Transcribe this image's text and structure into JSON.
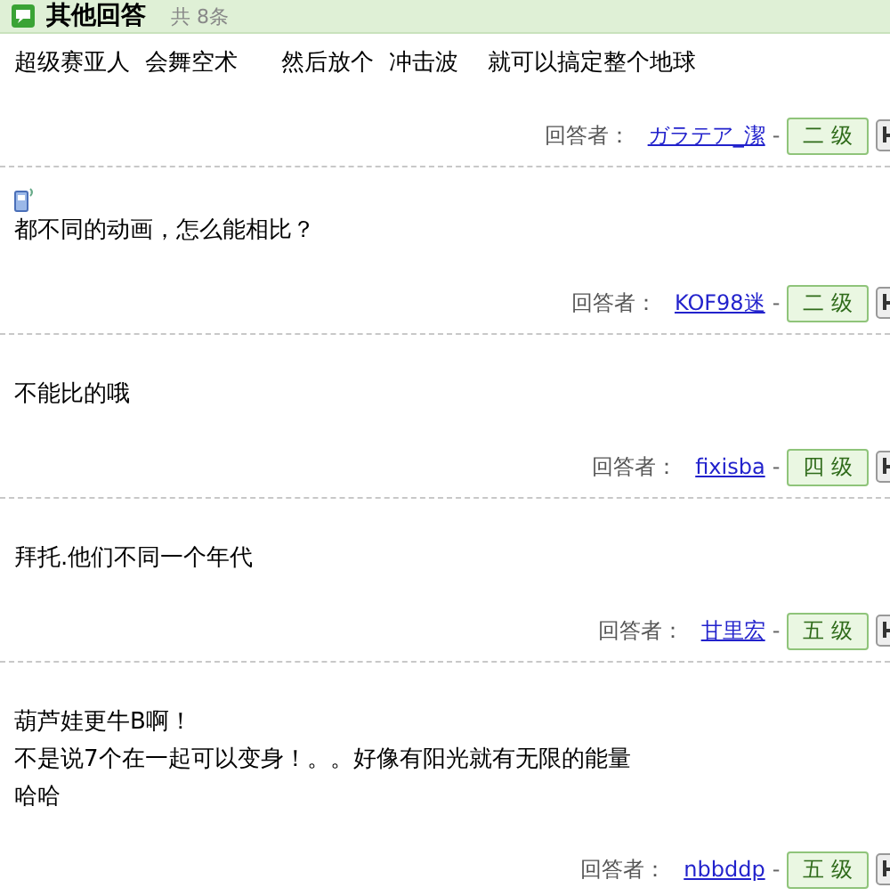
{
  "header": {
    "title": "其他回答",
    "count": "共 8条"
  },
  "answers": [
    {
      "lines": [
        "超级赛亚人  会舞空术      然后放个  冲击波    就可以搞定整个地球"
      ],
      "from_mobile": false,
      "label": "回答者：",
      "user": "ガラテア_潔",
      "dash": "-",
      "level": "二 级"
    },
    {
      "lines": [
        "都不同的动画，怎么能相比？"
      ],
      "from_mobile": true,
      "label": "回答者：",
      "user": "KOF98迷",
      "dash": "-",
      "level": "二 级"
    },
    {
      "lines": [
        "不能比的哦"
      ],
      "from_mobile": false,
      "label": "回答者：",
      "user": "fixisba",
      "dash": "-",
      "level": "四 级"
    },
    {
      "lines": [
        "拜托.他们不同一个年代"
      ],
      "from_mobile": false,
      "label": "回答者：",
      "user": "甘里宏",
      "dash": "-",
      "level": "五 级"
    },
    {
      "lines": [
        "葫芦娃更牛B啊！",
        "不是说7个在一起可以变身！。。好像有阳光就有无限的能量",
        "哈哈"
      ],
      "from_mobile": false,
      "label": "回答者：",
      "user": "nbbddp",
      "dash": "-",
      "level": "五 级"
    }
  ]
}
